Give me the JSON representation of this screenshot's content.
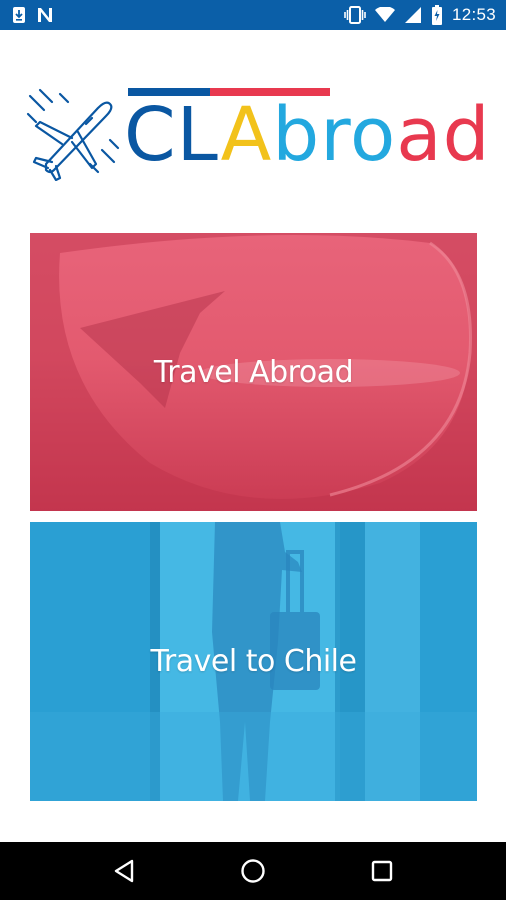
{
  "status_bar": {
    "time": "12:53",
    "icons": [
      "download-icon",
      "notification-n-icon",
      "vibrate-icon",
      "wifi-icon",
      "signal-icon",
      "battery-icon"
    ],
    "background": "#0b5fa8"
  },
  "logo": {
    "parts": {
      "cl": "CL",
      "a": "A",
      "bro": "bro",
      "ad": "ad"
    },
    "colors": {
      "blue": "#0a57a2",
      "yellow": "#f2c21b",
      "light_blue": "#23a8df",
      "red": "#e8394f"
    },
    "icon": "airplane-icon"
  },
  "cards": {
    "abroad": {
      "label": "Travel Abroad",
      "color": "#d9475c"
    },
    "chile": {
      "label": "Travel to Chile",
      "color": "#2a9fd3"
    }
  },
  "nav_bar": {
    "buttons": [
      "back-icon",
      "home-icon",
      "recents-icon"
    ]
  }
}
